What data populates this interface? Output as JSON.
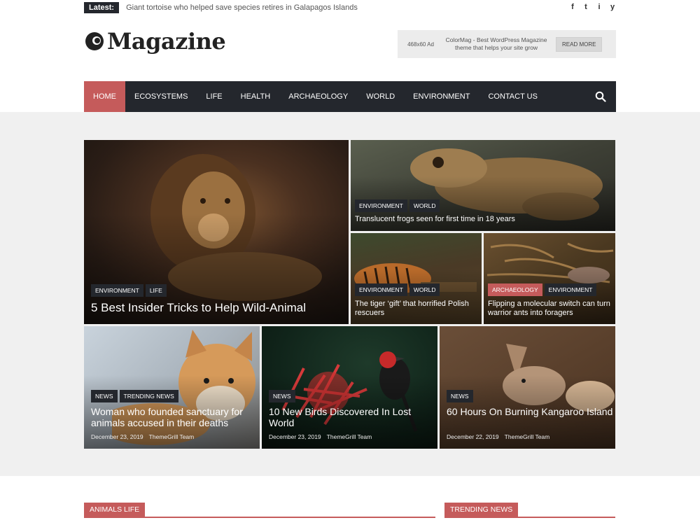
{
  "topbar": {
    "latest_label": "Latest:",
    "latest_text": "Giant tortoise who helped save species retires in Galapagos Islands",
    "socials": [
      "f",
      "t",
      "i",
      "y"
    ]
  },
  "header": {
    "logo_text": "Magazine",
    "ad": {
      "size": "468x60 Ad",
      "text": "ColorMag - Best WordPress Magazine theme that helps your site grow",
      "button": "READ MORE"
    }
  },
  "nav": {
    "items": [
      "HOME",
      "ECOSYSTEMS",
      "LIFE",
      "HEALTH",
      "ARCHAEOLOGY",
      "WORLD",
      "ENVIRONMENT",
      "CONTACT US"
    ],
    "active": "HOME"
  },
  "featured": {
    "lion": {
      "tags": [
        "ENVIRONMENT",
        "LIFE"
      ],
      "title": "5 Best Insider Tricks to Help Wild-Animal"
    },
    "frog": {
      "tags": [
        "ENVIRONMENT",
        "WORLD"
      ],
      "title": "Translucent frogs seen for first time in 18 years"
    },
    "tiger": {
      "tags": [
        "ENVIRONMENT",
        "WORLD"
      ],
      "title": "The tiger ‘gift’ that horrified Polish rescuers"
    },
    "ants": {
      "tags": [
        "ARCHAEOLOGY",
        "ENVIRONMENT"
      ],
      "title": "Flipping a molecular switch can turn warrior ants into foragers"
    }
  },
  "posts": [
    {
      "tags": [
        "NEWS",
        "TRENDING NEWS"
      ],
      "title": "Woman who founded sanctuary for animals accused in their deaths",
      "date": "December 23, 2019",
      "author": "ThemeGrill Team"
    },
    {
      "tags": [
        "NEWS"
      ],
      "title": "10 New Birds Discovered In Lost World",
      "date": "December 23, 2019",
      "author": "ThemeGrill Team"
    },
    {
      "tags": [
        "NEWS"
      ],
      "title": "60 Hours On Burning Kangaroo Island",
      "date": "December 22, 2019",
      "author": "ThemeGrill Team"
    }
  ],
  "sections": {
    "left": "ANIMALS LIFE",
    "right": "TRENDING NEWS"
  },
  "colors": {
    "accent": "#c55b5b",
    "nav_bg": "#24272d"
  }
}
